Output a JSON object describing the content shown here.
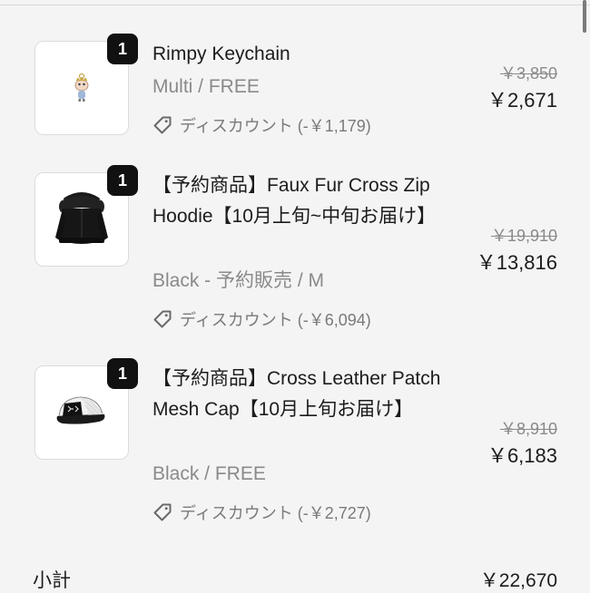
{
  "items": [
    {
      "quantity": "1",
      "title": "Rimpy Keychain",
      "variant": "Multi / FREE",
      "discount": "ディスカウント (-￥1,179)",
      "original_price": "￥3,850",
      "price": "￥2,671",
      "image_icon": "keychain-figure"
    },
    {
      "quantity": "1",
      "title": "【予約商品】Faux Fur Cross Zip Hoodie【10月上旬~中旬お届け】",
      "variant": "Black - 予約販売 / M",
      "discount": "ディスカウント (-￥6,094)",
      "original_price": "￥19,910",
      "price": "￥13,816",
      "image_icon": "black-hoodie"
    },
    {
      "quantity": "1",
      "title": "【予約商品】Cross Leather Patch Mesh Cap【10月上旬お届け】",
      "variant": "Black / FREE",
      "discount": "ディスカウント (-￥2,727)",
      "original_price": "￥8,910",
      "price": "￥6,183",
      "image_icon": "mesh-cap"
    }
  ],
  "subtotal": {
    "label": "小計",
    "value": "￥22,670"
  },
  "colors": {
    "background": "#f4f4f4",
    "badge": "#111111",
    "muted_text": "#8a8a8a"
  }
}
